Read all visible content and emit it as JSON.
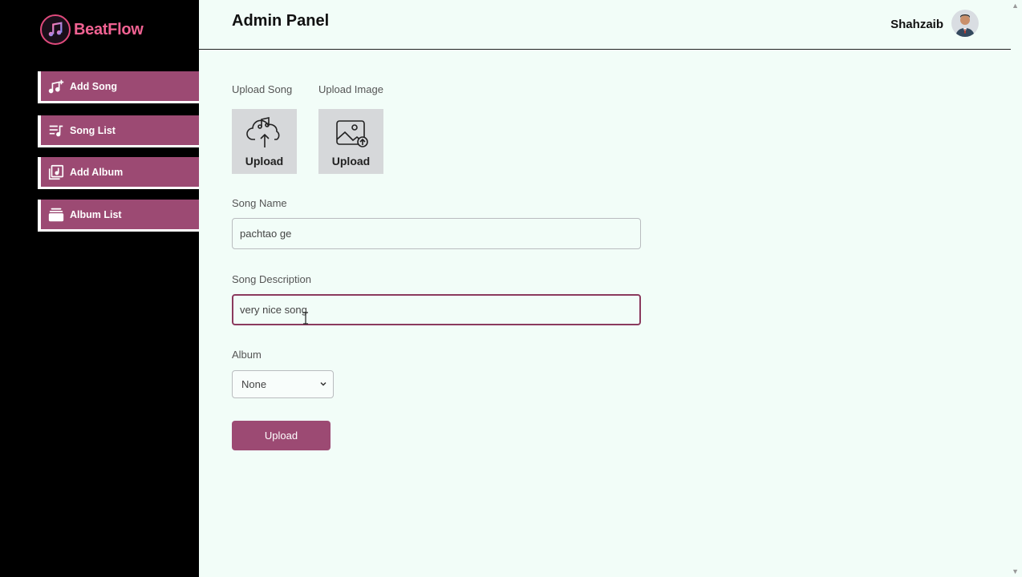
{
  "app": {
    "name": "BeatFlow"
  },
  "sidebar": {
    "items": [
      {
        "label": "Add Song",
        "icon": "music-note-plus-icon"
      },
      {
        "label": "Song List",
        "icon": "playlist-icon"
      },
      {
        "label": "Add Album",
        "icon": "album-add-icon"
      },
      {
        "label": "Album List",
        "icon": "album-stack-icon"
      }
    ]
  },
  "header": {
    "title": "Admin Panel",
    "user_name": "Shahzaib"
  },
  "form": {
    "upload_song_label": "Upload Song",
    "upload_image_label": "Upload Image",
    "upload_song_box_text": "Upload",
    "upload_image_box_text": "Upload",
    "song_name_label": "Song Name",
    "song_name_value": "pachtao ge",
    "song_description_label": "Song Description",
    "song_description_value": "very nice song",
    "album_label": "Album",
    "album_selected": "None",
    "submit_label": "Upload"
  },
  "colors": {
    "accent": "#9c4a73",
    "sidebar_bg": "#000000",
    "main_bg": "#f2fdf8",
    "logo": "#f06292"
  }
}
